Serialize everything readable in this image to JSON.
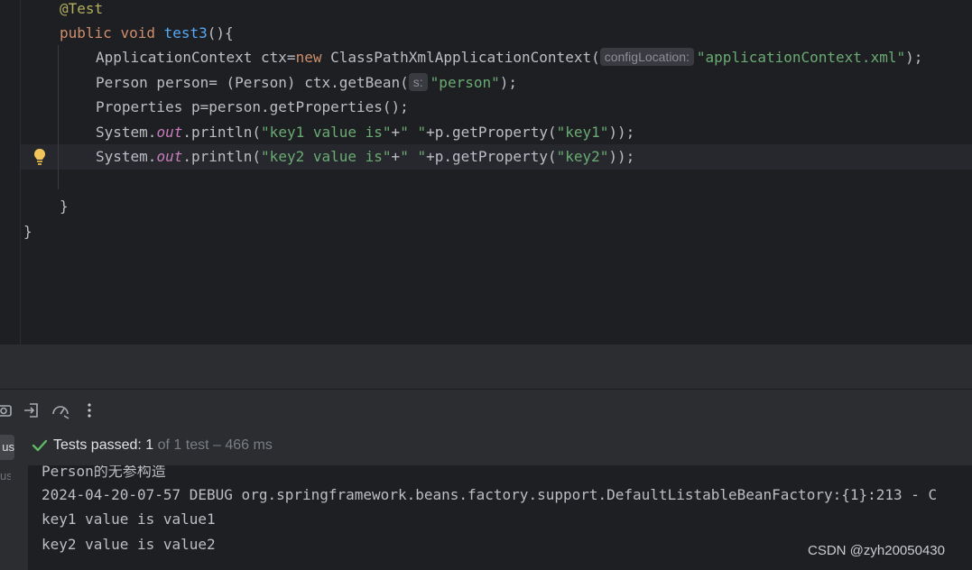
{
  "editor": {
    "lines": {
      "annotation": "@Test",
      "method_kw1": "public",
      "method_kw2": "void",
      "method_name": "test3",
      "method_tail": "(){",
      "l3_pre": "ApplicationContext ctx=",
      "l3_new": "new",
      "l3_mid": " ClassPathXmlApplicationContext(",
      "l3_hint": "configLocation:",
      "l3_str": "\"applicationContext.xml\"",
      "l3_tail": ");",
      "l4_pre": "Person person= (Person) ctx.getBean(",
      "l4_hint": "s:",
      "l4_str": "\"person\"",
      "l4_tail": ");",
      "l5": "Properties p=person.getProperties();",
      "l6_pre": "System.",
      "l6_field": "out",
      "l6_mid": ".println(",
      "l6_str1": "\"key1 value is\"",
      "l6_plus": "+",
      "l6_str2": "\" \"",
      "l6_mid2": "+p.getProperty(",
      "l6_str3": "\"key1\"",
      "l6_tail": "));",
      "l7_pre": "System.",
      "l7_field": "out",
      "l7_mid": ".println(",
      "l7_str1": "\"key2 value is\"",
      "l7_plus": "+",
      "l7_str2": "\" \"",
      "l7_mid2": "+p.getProperty(",
      "l7_str3": "\"key2\"",
      "l7_tail": "));",
      "close_method": "}",
      "close_class": "}"
    }
  },
  "test_status": {
    "label": "Tests passed:",
    "passed": "1",
    "detail": "of 1 test – 466 ms"
  },
  "side_tabs": {
    "tab1": "us",
    "tab2": "us"
  },
  "console": {
    "line1": "Person的无参构造",
    "line2": "2024-04-20-07-57 DEBUG org.springframework.beans.factory.support.DefaultListableBeanFactory:{1}:213 - C",
    "line3": "key1 value is value1",
    "line4": "key2 value is value2"
  },
  "watermark": "CSDN @zyh20050430",
  "colors": {
    "background": "#1e1f22",
    "keyword": "#cf8e6d",
    "string": "#6aab73",
    "method": "#56a8f5",
    "success": "#5fb865"
  }
}
